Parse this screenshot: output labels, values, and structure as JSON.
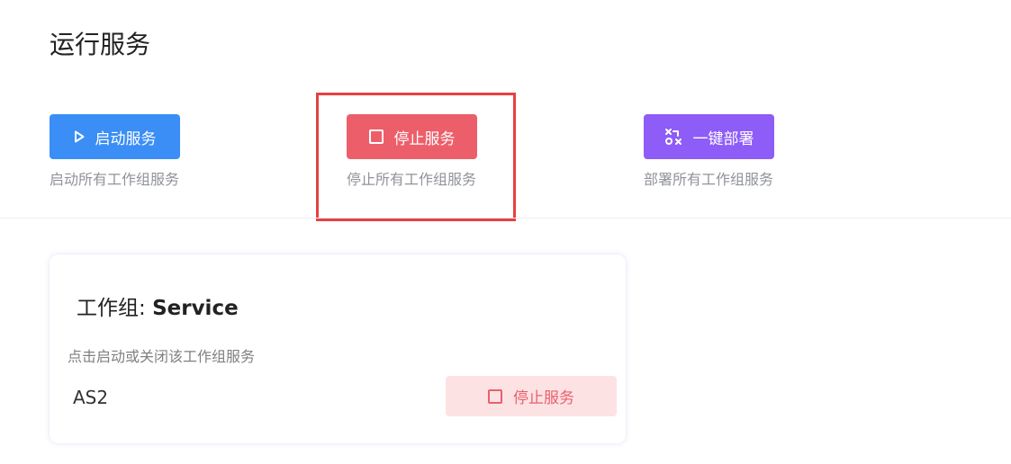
{
  "page": {
    "title": "运行服务"
  },
  "actions": {
    "start": {
      "label": "启动服务",
      "description": "启动所有工作组服务",
      "icon": "play-icon",
      "color": "#3a8ef6"
    },
    "stop": {
      "label": "停止服务",
      "description": "停止所有工作组服务",
      "icon": "stop-square-icon",
      "color": "#ec5f6a"
    },
    "deploy": {
      "label": "一键部署",
      "description": "部署所有工作组服务",
      "icon": "deploy-icon",
      "color": "#8e5cf7"
    }
  },
  "workgroup_card": {
    "title_prefix": "工作组: ",
    "title_name": "Service",
    "description": "点击启动或关闭该工作组服务",
    "service_name": "AS2",
    "button_label": "停止服务",
    "button_icon": "stop-square-icon"
  }
}
